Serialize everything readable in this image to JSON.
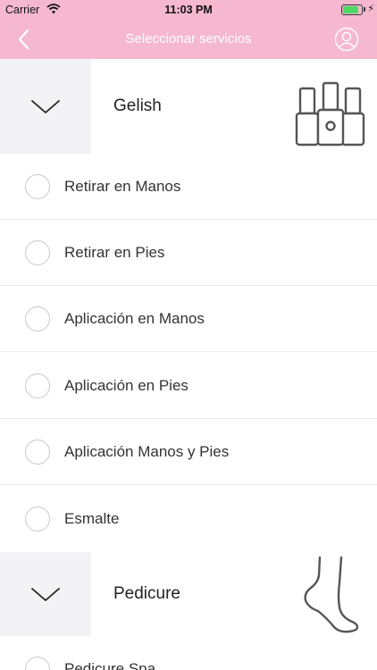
{
  "status_bar": {
    "carrier": "Carrier",
    "time": "11:03 PM",
    "battery_level": 0.85
  },
  "nav": {
    "title": "Seleccionar servicios"
  },
  "sections": [
    {
      "name": "Gelish",
      "picture": "nail-polish-bottles",
      "services": [
        "Retirar en Manos",
        "Retirar en Pies",
        "Aplicación en Manos",
        "Aplicación en Pies",
        "Aplicación Manos y Pies",
        "Esmalte"
      ]
    },
    {
      "name": "Pedicure",
      "picture": "foot",
      "services": [
        "Pedicure Spa"
      ]
    }
  ],
  "colors": {
    "header_bg": "#f5b8cf",
    "toggle_bg": "#f3f3f5",
    "divider": "#ededed"
  }
}
